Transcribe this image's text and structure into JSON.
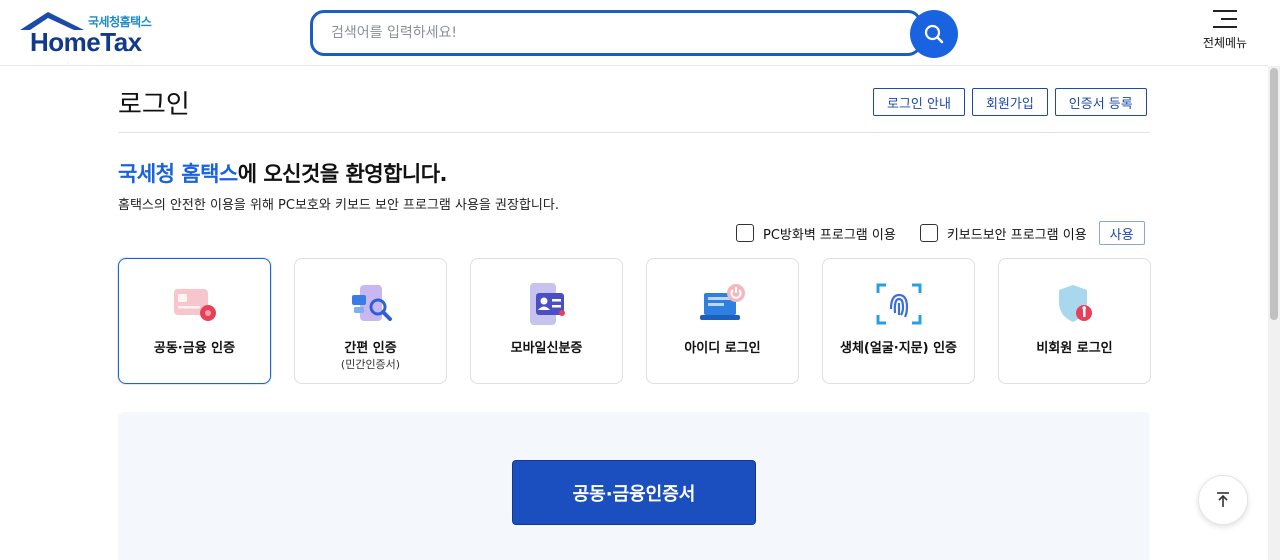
{
  "header": {
    "logo_sub": "국세청홈택스",
    "logo_main": "HomeTax",
    "search_placeholder": "검색어를 입력하세요!",
    "menu_label": "전체메뉴"
  },
  "page": {
    "title": "로그인",
    "buttons": [
      "로그인 안내",
      "회원가입",
      "인증서 등록"
    ]
  },
  "welcome": {
    "highlight": "국세청 홈택스",
    "rest": "에 오신것을 환영합니다.",
    "description": "홈택스의 안전한 이용을 위해 PC보호와 키보드 보안 프로그램 사용을 권장합니다."
  },
  "options": {
    "pc_firewall": "PC방화벽 프로그램 이용",
    "keyboard_security": "키보드보안 프로그램 이용",
    "use_button": "사용"
  },
  "login_methods": [
    {
      "label": "공동·금융 인증",
      "sub": "",
      "icon": "certificate-card-icon"
    },
    {
      "label": "간편 인증",
      "sub": "(민간인증서)",
      "icon": "simple-auth-icon"
    },
    {
      "label": "모바일신분증",
      "sub": "",
      "icon": "mobile-id-icon"
    },
    {
      "label": "아이디 로그인",
      "sub": "",
      "icon": "laptop-login-icon"
    },
    {
      "label": "생체(얼굴·지문) 인증",
      "sub": "",
      "icon": "fingerprint-icon"
    },
    {
      "label": "비회원 로그인",
      "sub": "",
      "icon": "shield-icon"
    }
  ],
  "panel": {
    "primary_button": "공동·금융인증서"
  },
  "colors": {
    "accent": "#1a63e0",
    "brand_dark": "#123a8c",
    "primary_button": "#1b4fbf"
  }
}
